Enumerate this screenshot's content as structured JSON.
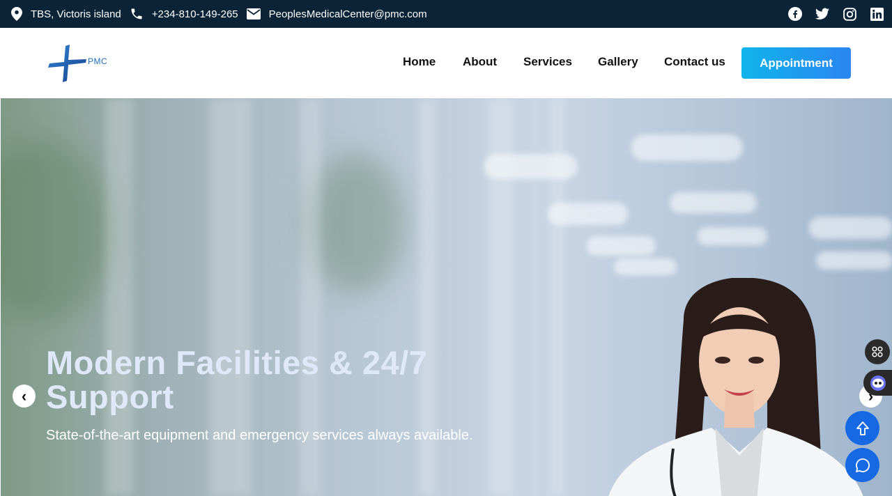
{
  "topbar": {
    "address": "TBS, Victoris island",
    "phone": "+234-810-149-265",
    "email": "PeoplesMedicalCenter@pmc.com",
    "social_icons": [
      "facebook-icon",
      "twitter-icon",
      "instagram-icon",
      "linkedin-icon"
    ]
  },
  "header": {
    "logo_text": "PMC",
    "nav": [
      "Home",
      "About",
      "Services",
      "Gallery",
      "Contact us"
    ],
    "cta": "Appointment"
  },
  "hero": {
    "title": "Modern Facilities & 24/7 Support",
    "subtitle": "State-of-the-art equipment and emergency services always available.",
    "prev": "‹",
    "next": "›"
  },
  "colors": {
    "topbar_bg": "#0b2337",
    "accent": "#1a9df0",
    "fab": "#1668e3"
  }
}
